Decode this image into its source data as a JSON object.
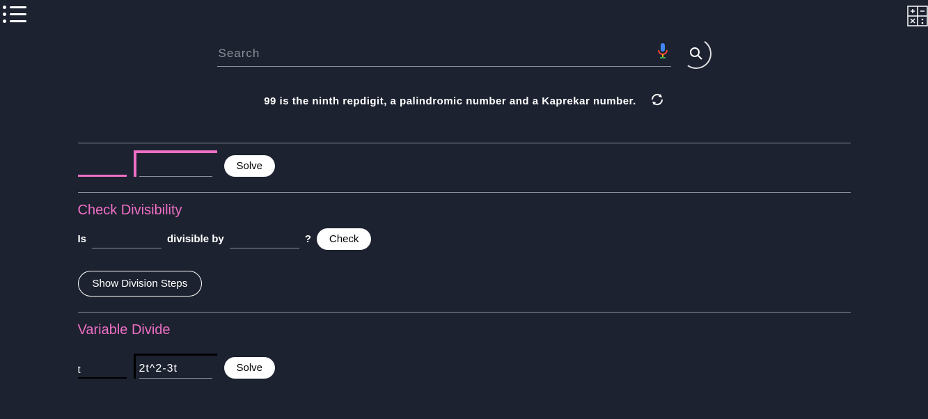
{
  "header": {
    "search_placeholder": "Search"
  },
  "fact": {
    "text": "99 is the ninth repdigit, a palindromic number and a Kaprekar number."
  },
  "long_division": {
    "divisor": "",
    "dividend": "",
    "solve_label": "Solve"
  },
  "divisibility": {
    "title": "Check Divisibility",
    "is_label": "Is",
    "divisible_by_label": "divisible by",
    "question_mark": "?",
    "value_a": "",
    "value_b": "",
    "check_label": "Check",
    "steps_button": "Show Division Steps"
  },
  "variable_divide": {
    "title": "Variable Divide",
    "divisor": "t",
    "dividend": "2t^2-3t",
    "solve_label": "Solve"
  }
}
